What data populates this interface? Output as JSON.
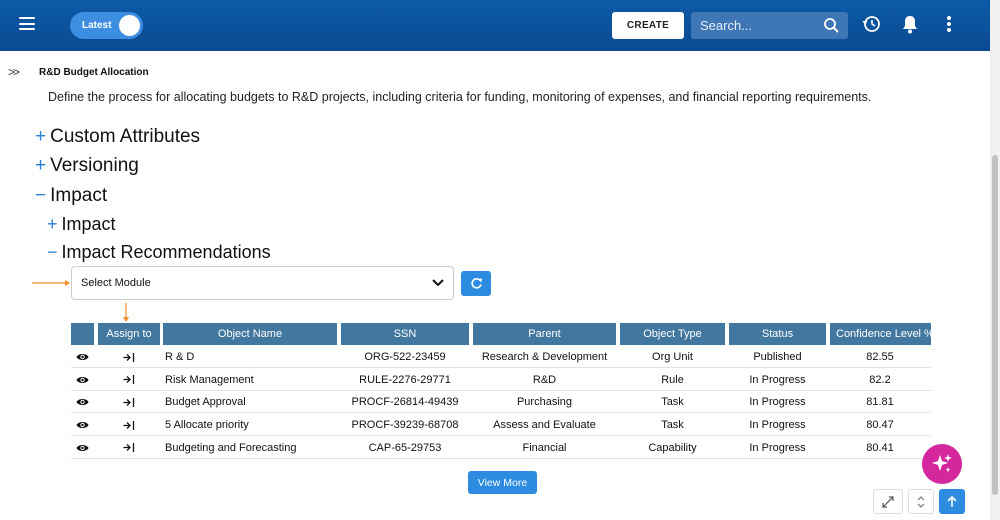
{
  "topbar": {
    "toggle_label": "Latest",
    "create_label": "CREATE",
    "search_placeholder": "Search..."
  },
  "breadcrumb": "R&D Budget Allocation",
  "description": "Define the process for allocating budgets to R&D projects, including criteria for funding, monitoring of expenses, and financial reporting requirements.",
  "tree": {
    "custom_attributes": {
      "sign": "+",
      "label": "Custom Attributes"
    },
    "versioning": {
      "sign": "+",
      "label": "Versioning"
    },
    "impact": {
      "sign": "−",
      "label": "Impact"
    },
    "impact_sub": {
      "sign": "+",
      "label": "Impact"
    },
    "impact_recommendations": {
      "sign": "−",
      "label": "Impact Recommendations"
    }
  },
  "module_select": {
    "selected": "Select Module"
  },
  "table": {
    "headers": [
      "",
      "Assign to",
      "Object Name",
      "SSN",
      "Parent",
      "Object Type",
      "Status",
      "Confidence Level %"
    ],
    "rows": [
      {
        "name": "R & D",
        "ssn": "ORG-522-23459",
        "parent": "Research & Development",
        "type": "Org Unit",
        "status": "Published",
        "confidence": "82.55"
      },
      {
        "name": "Risk Management",
        "ssn": "RULE-2276-29771",
        "parent": "R&D",
        "type": "Rule",
        "status": "In Progress",
        "confidence": "82.2"
      },
      {
        "name": "Budget Approval",
        "ssn": "PROCF-26814-49439",
        "parent": "Purchasing",
        "type": "Task",
        "status": "In Progress",
        "confidence": "81.81"
      },
      {
        "name": "5 Allocate priority",
        "ssn": "PROCF-39239-68708",
        "parent": "Assess and Evaluate",
        "type": "Task",
        "status": "In Progress",
        "confidence": "80.47"
      },
      {
        "name": "Budgeting and Forecasting",
        "ssn": "CAP-65-29753",
        "parent": "Financial",
        "type": "Capability",
        "status": "In Progress",
        "confidence": "80.41"
      }
    ]
  },
  "view_more_label": "View More",
  "colors": {
    "accent": "#2d8ce0",
    "header_bg": "#0d5aa7",
    "table_header": "#42789f",
    "annotation_arrow": "#f28c28",
    "ai_fab": "#d4279e"
  }
}
